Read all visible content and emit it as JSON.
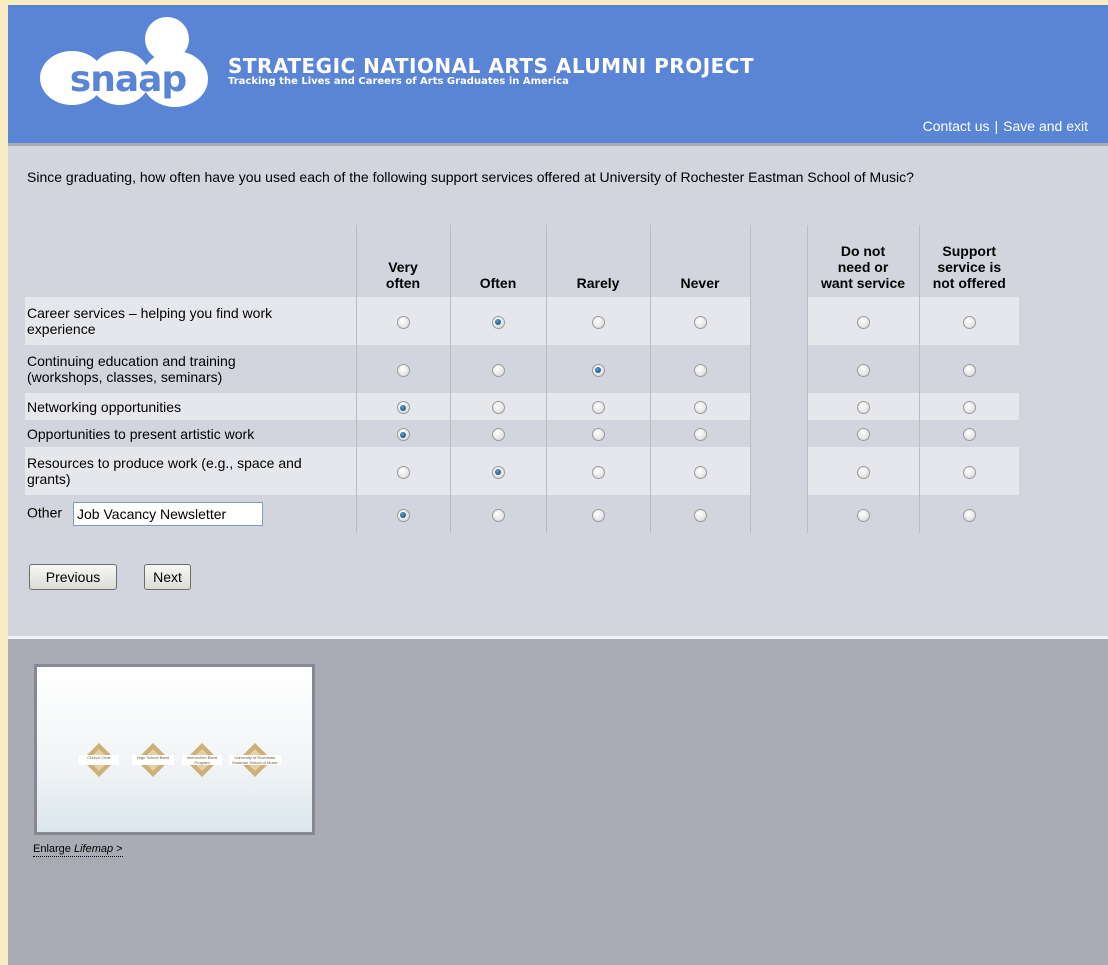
{
  "header": {
    "logo_text": "snaap",
    "title": "STRATEGIC NATIONAL ARTS ALUMNI PROJECT",
    "subtitle": "Tracking the Lives and Careers of Arts Graduates in America",
    "links": {
      "contact": "Contact us",
      "separator": "|",
      "save_exit": "Save and exit"
    },
    "colors": {
      "background": "#5a85d6",
      "text": "#ffffff"
    }
  },
  "question": {
    "text": "Since graduating, how often have you used each of the following support services offered at University of Rochester Eastman School of Music?",
    "columns": [
      "Very often",
      "Often",
      "Rarely",
      "Never",
      "Do not need or want service",
      "Support service is not offered"
    ],
    "column_lines": [
      [
        "Very",
        "often"
      ],
      [
        "Often"
      ],
      [
        "Rarely"
      ],
      [
        "Never"
      ],
      [
        "Do not",
        "need or",
        "want service"
      ],
      [
        "Support",
        "service is",
        "not offered"
      ]
    ],
    "rows": [
      {
        "lines": [
          "Career services – helping you find work",
          "experience"
        ],
        "selected": 1
      },
      {
        "lines": [
          "Continuing education and training",
          "(workshops, classes, seminars)"
        ],
        "selected": 2
      },
      {
        "lines": [
          "Networking opportunities"
        ],
        "selected": 0
      },
      {
        "lines": [
          "Opportunities to present artistic work"
        ],
        "selected": 0
      },
      {
        "lines": [
          "Resources to produce work (e.g., space and",
          "grants)"
        ],
        "selected": 1
      },
      {
        "lines": [
          "Other"
        ],
        "selected": 0,
        "other_value": "Job Vacancy Newsletter"
      }
    ]
  },
  "buttons": {
    "previous": "Previous",
    "next": "Next"
  },
  "lifemap": {
    "nodes": [
      "Church Choir",
      "High School Band",
      "Interlochen Band Program",
      "University of Rochester Eastman School of Music"
    ],
    "enlarge_text": "Enlarge ",
    "enlarge_em": "Lifemap",
    "enlarge_suffix": " >"
  }
}
